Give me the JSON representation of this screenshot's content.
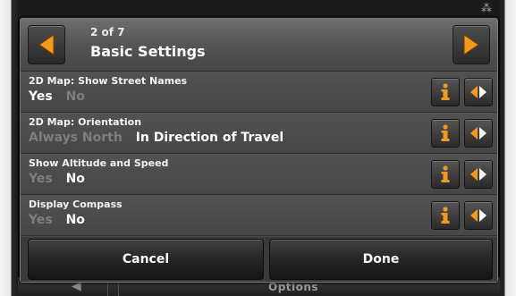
{
  "header": {
    "page_count": "2 of 7",
    "title": "Basic Settings"
  },
  "settings": [
    {
      "label": "2D Map: Show Street Names",
      "options": [
        "Yes",
        "No"
      ],
      "selected": "Yes"
    },
    {
      "label": "2D Map: Orientation",
      "options": [
        "Always North",
        "In Direction of Travel"
      ],
      "selected": "In Direction of Travel"
    },
    {
      "label": "Show Altitude and Speed",
      "options": [
        "Yes",
        "No"
      ],
      "selected": "No"
    },
    {
      "label": "Display Compass",
      "options": [
        "Yes",
        "No"
      ],
      "selected": "No"
    }
  ],
  "footer": {
    "cancel_label": "Cancel",
    "done_label": "Done"
  },
  "background": {
    "bottom_label": "Options"
  },
  "icons": {
    "prev": "arrow-left-icon",
    "next": "arrow-right-icon",
    "info": "info-icon",
    "toggle": "left-right-arrows-icon"
  },
  "colors": {
    "accent": "#f39a1c",
    "selected_text": "#ffffff",
    "unselected_text": "#7e7e7e"
  }
}
